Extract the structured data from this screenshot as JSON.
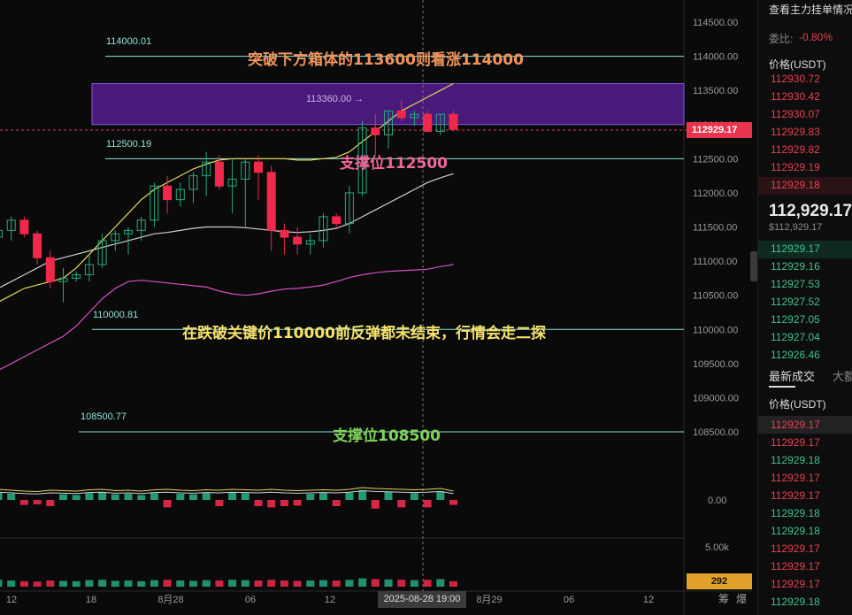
{
  "chart": {
    "y_axis_labels": [
      "114500.00",
      "114000.00",
      "113500.00",
      "113000.00",
      "112500.00",
      "112000.00",
      "111500.00",
      "111000.00",
      "110500.00",
      "110000.00",
      "109500.00",
      "109000.00",
      "108500.00"
    ],
    "vol_axis_labels": [
      "0.00",
      "5.00k"
    ],
    "x_axis_labels": [
      "12",
      "18",
      "8月28",
      "06",
      "12",
      "8月29",
      "06",
      "12"
    ],
    "current_price_tag": "112929.17",
    "volume_tag": "292",
    "crosshair_time": "2025-08-28 19:00",
    "bottom_right_labels": [
      "筹",
      "爆"
    ],
    "level_labels": {
      "l114000": "114000.01",
      "l112500": "112500.19",
      "l110000": "110000.81",
      "l108500": "108500.77",
      "box_high": "113360.00"
    },
    "annotations": {
      "a1": "突破下方箱体的113600则看涨114000",
      "a2": "支撑位112500",
      "a3": "在跌破关键价110000前反弹都未结束，行情会走二探",
      "a4": "支撑位108500"
    },
    "colors": {
      "up": "#26a97f",
      "down": "#f0294a",
      "ma_yellow": "#e7d65a",
      "ma_white": "#cfcfcf",
      "ma_pink": "#d74ec4",
      "box": "#5a1f9a",
      "level_line": "#8fe3d8"
    }
  },
  "chart_data": {
    "type": "candlestick",
    "ylim": [
      108200,
      114700
    ],
    "candles": [
      [
        111350,
        111500,
        111200,
        111450
      ],
      [
        111450,
        111650,
        111300,
        111600
      ],
      [
        111600,
        111650,
        111350,
        111400
      ],
      [
        111400,
        111450,
        110950,
        111050
      ],
      [
        111050,
        111150,
        110600,
        110700
      ],
      [
        110700,
        110900,
        110400,
        110750
      ],
      [
        110750,
        110850,
        110700,
        110800
      ],
      [
        110800,
        111100,
        110700,
        110950
      ],
      [
        110950,
        111400,
        110900,
        111300
      ],
      [
        111300,
        111450,
        111150,
        111400
      ],
      [
        111400,
        111500,
        111100,
        111450
      ],
      [
        111450,
        111650,
        111300,
        111600
      ],
      [
        111600,
        112150,
        111500,
        112100
      ],
      [
        112100,
        112250,
        111700,
        111900
      ],
      [
        111900,
        112150,
        111800,
        112050
      ],
      [
        112050,
        112300,
        111850,
        112250
      ],
      [
        112250,
        112600,
        111950,
        112450
      ],
      [
        112450,
        112550,
        112050,
        112100
      ],
      [
        112100,
        112500,
        111700,
        112200
      ],
      [
        112200,
        112500,
        111500,
        112450
      ],
      [
        112450,
        112550,
        111900,
        112300
      ],
      [
        112300,
        112400,
        111150,
        111450
      ],
      [
        111450,
        111550,
        111100,
        111350
      ],
      [
        111350,
        111500,
        111100,
        111250
      ],
      [
        111250,
        111400,
        111100,
        111300
      ],
      [
        111300,
        111700,
        111200,
        111650
      ],
      [
        111650,
        111700,
        111500,
        111550
      ],
      [
        111550,
        112100,
        111400,
        112000
      ],
      [
        112000,
        113050,
        111950,
        112950
      ],
      [
        112950,
        113150,
        112550,
        112850
      ],
      [
        112850,
        113200,
        112650,
        113200
      ],
      [
        113200,
        113360,
        113050,
        113100
      ],
      [
        113100,
        113200,
        112980,
        113150
      ],
      [
        113150,
        113200,
        112950,
        112900
      ],
      [
        112900,
        113150,
        112850,
        113150
      ],
      [
        113150,
        113200,
        112900,
        112929
      ]
    ],
    "ma_short": [
      110400,
      110500,
      110600,
      110650,
      110700,
      110750,
      110900,
      111100,
      111300,
      111500,
      111700,
      111900,
      112050,
      112150,
      112250,
      112350,
      112420,
      112480,
      112500,
      112500,
      112500,
      112500,
      112500,
      112480,
      112480,
      112500,
      112520,
      112600,
      112750,
      112900,
      113050,
      113200,
      113300,
      113400,
      113500,
      113600
    ],
    "ma_mid": [
      110600,
      110700,
      110800,
      110900,
      111000,
      111050,
      111100,
      111150,
      111200,
      111250,
      111300,
      111350,
      111400,
      111420,
      111450,
      111480,
      111500,
      111500,
      111500,
      111490,
      111470,
      111450,
      111430,
      111420,
      111430,
      111450,
      111480,
      111550,
      111650,
      111750,
      111850,
      111950,
      112050,
      112150,
      112220,
      112280
    ],
    "ma_long": [
      109400,
      109500,
      109600,
      109700,
      109800,
      109900,
      110050,
      110250,
      110450,
      110600,
      110700,
      110720,
      110700,
      110680,
      110660,
      110640,
      110620,
      110560,
      110520,
      110500,
      110520,
      110560,
      110590,
      110600,
      110620,
      110650,
      110700,
      110760,
      110800,
      110830,
      110850,
      110860,
      110870,
      110880,
      110920,
      110950
    ],
    "volumes": [
      0.6,
      0.5,
      0.4,
      0.35,
      0.5,
      0.45,
      0.4,
      0.55,
      0.6,
      0.45,
      0.5,
      0.4,
      0.55,
      0.6,
      0.5,
      0.45,
      0.55,
      0.5,
      0.6,
      0.55,
      0.5,
      0.6,
      0.5,
      0.45,
      0.5,
      0.55,
      0.5,
      0.6,
      0.8,
      0.7,
      0.65,
      0.6,
      0.55,
      0.6,
      0.7,
      0.4
    ]
  },
  "sidebar": {
    "title": "查看主力挂单情况",
    "ratio_label": "委比:",
    "ratio_value": "-0.80%",
    "price_header": "价格(USDT)",
    "asks": [
      "112930.72",
      "112930.42",
      "112930.07",
      "112929.83",
      "112929.82",
      "112929.19",
      "112929.18"
    ],
    "last_price": "112,929.17",
    "last_price_usd": "$112,929.17",
    "bids": [
      "112929.17",
      "112929.16",
      "112927.53",
      "112927.52",
      "112927.05",
      "112927.04",
      "112926.46"
    ],
    "tab_trades": "最新成交",
    "tab_big": "大额",
    "trades_header": "价格(USDT)",
    "trades": [
      {
        "p": "112929.17",
        "c": "red"
      },
      {
        "p": "112929.17",
        "c": "red"
      },
      {
        "p": "112929.18",
        "c": "grn"
      },
      {
        "p": "112929.17",
        "c": "red"
      },
      {
        "p": "112929.17",
        "c": "red"
      },
      {
        "p": "112929.18",
        "c": "grn"
      },
      {
        "p": "112929.18",
        "c": "grn"
      },
      {
        "p": "112929.17",
        "c": "red"
      },
      {
        "p": "112929.17",
        "c": "red"
      },
      {
        "p": "112929.17",
        "c": "red"
      },
      {
        "p": "112929.18",
        "c": "grn"
      }
    ]
  }
}
